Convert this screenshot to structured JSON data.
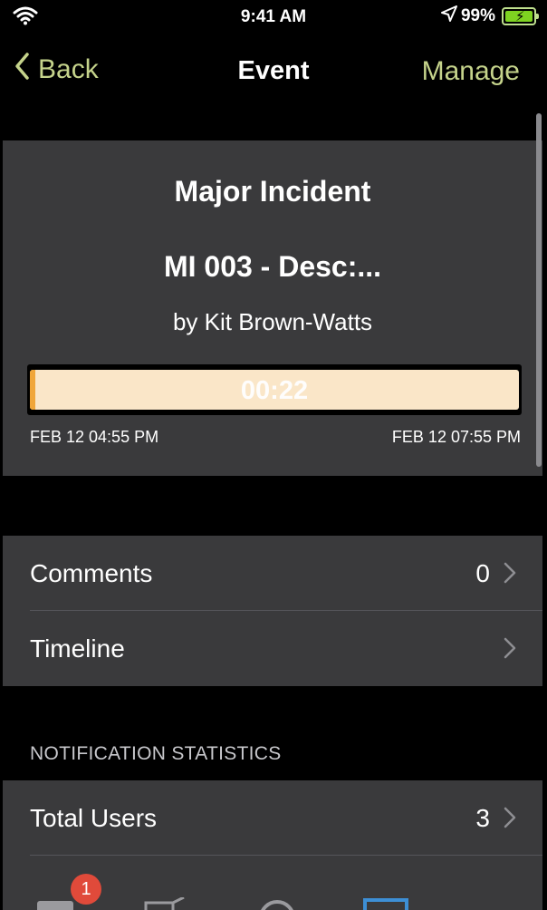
{
  "status_bar": {
    "time": "9:41 AM",
    "battery_percent": "99%",
    "icons": [
      "wifi-icon",
      "location-arrow-icon",
      "battery-charging-icon"
    ]
  },
  "nav": {
    "back_label": "Back",
    "title": "Event",
    "manage_label": "Manage",
    "accent_color": "#c5d38b"
  },
  "event": {
    "category": "Major Incident",
    "title": "MI 003 - Desc:...",
    "author": "by Kit Brown-Watts",
    "elapsed": "00:22",
    "elapsed_progress_fraction": 0.012,
    "start": "FEB 12 04:55 PM",
    "end": "FEB 12 07:55 PM",
    "progress_colors": {
      "fill": "#f0a63a",
      "track": "#fae6c8"
    }
  },
  "detail_rows": [
    {
      "label": "Comments",
      "value": "0"
    },
    {
      "label": "Timeline",
      "value": ""
    }
  ],
  "notification_statistics": {
    "header": "NOTIFICATION STATISTICS",
    "rows": [
      {
        "label": "Total Users",
        "value": "3"
      }
    ]
  },
  "tab_bar": {
    "badge_count": "1",
    "tabs": [
      "messages-tab-icon",
      "compose-tab-icon",
      "search-tab-icon",
      "screen-tab-icon"
    ]
  }
}
